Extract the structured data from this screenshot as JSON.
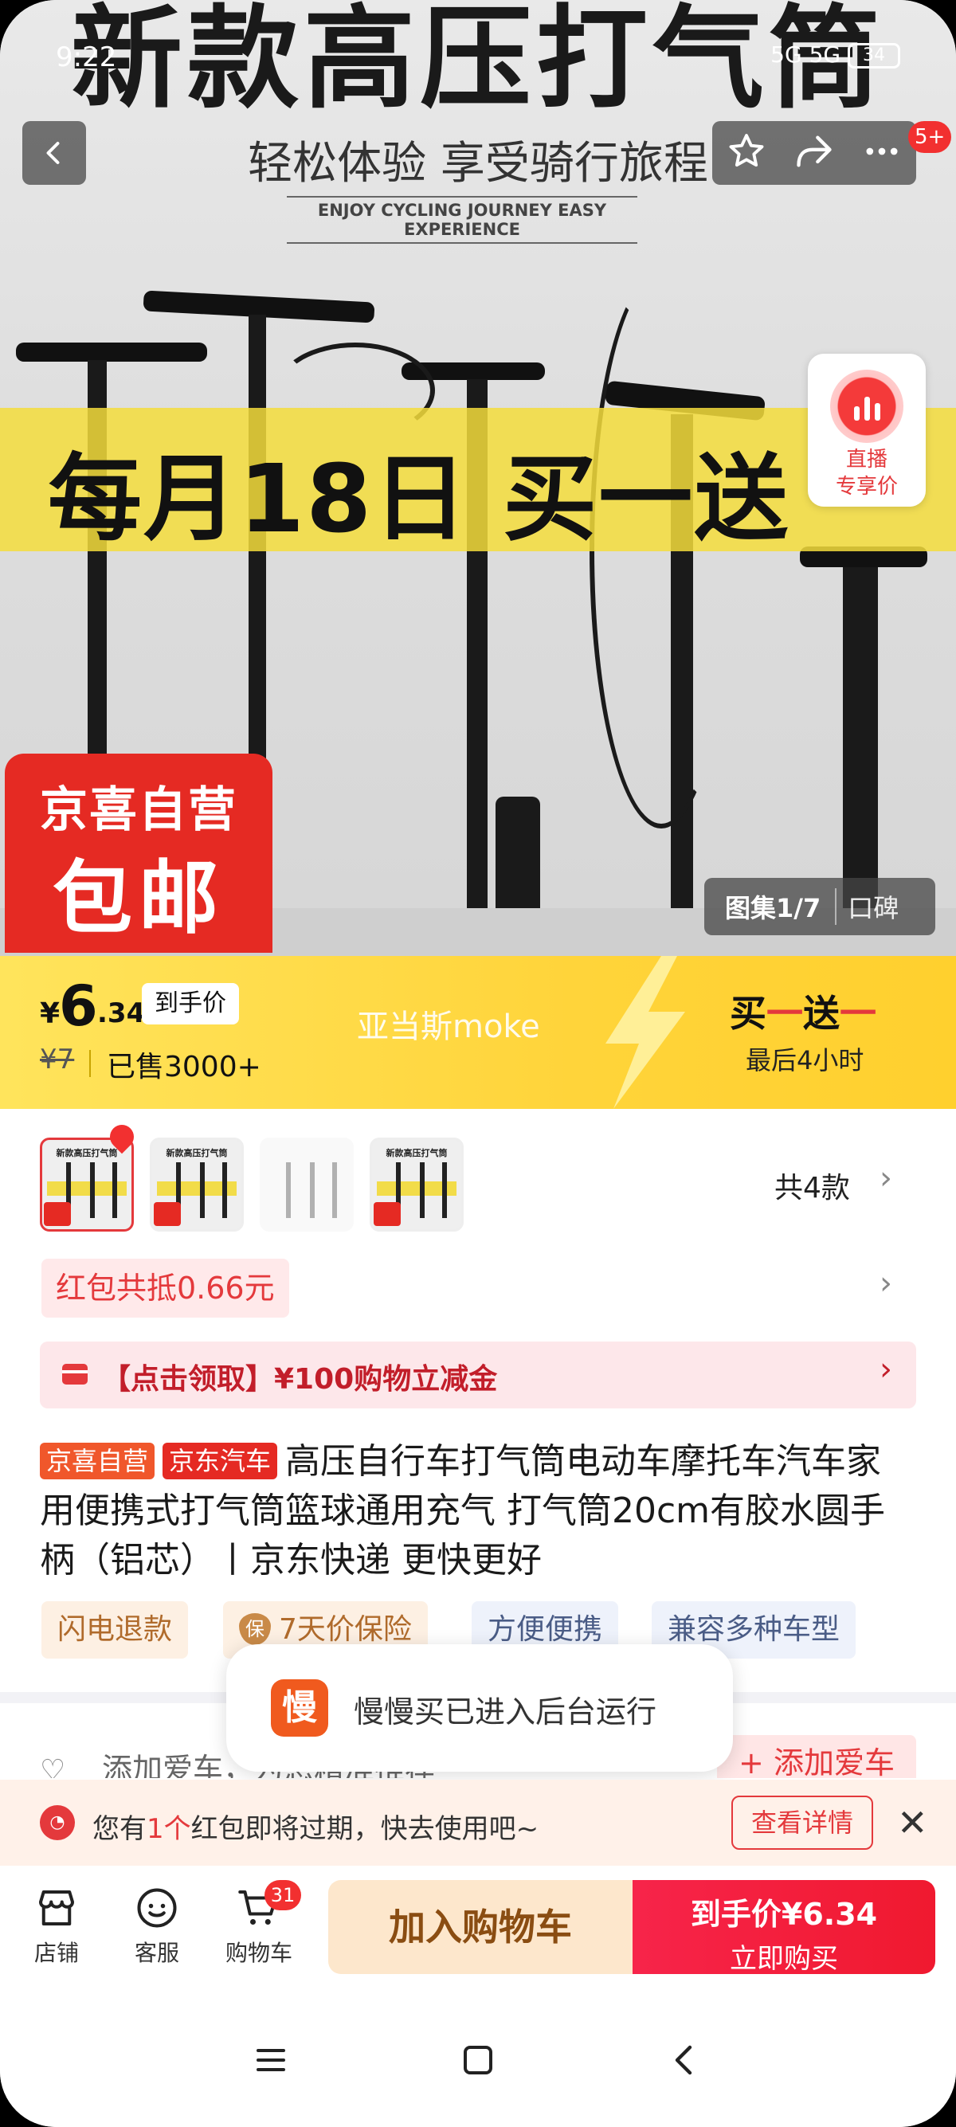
{
  "status_bar": {
    "time": "9:22",
    "network": "5G 5G",
    "battery": "34"
  },
  "hero": {
    "title": "新款高压打气筒",
    "subtitle": "轻松体验 享受骑行旅程",
    "subtitle_en": "ENJOY CYCLING JOURNEY EASY EXPERIENCE",
    "promo": "每月18日 买一送",
    "badge_line1": "京喜自营",
    "badge_line2": "包邮",
    "live_line1": "直播",
    "live_line2": "专享价",
    "gallery": "图集1/7",
    "reviews": "口碑",
    "message_badge": "5+"
  },
  "price_banner": {
    "currency": "¥",
    "price_int": "6",
    "price_dec": ".34",
    "price_tag": "到手价",
    "original_price": "¥7",
    "sold": "已售3000+",
    "watermark": "亚当斯moke",
    "buy_one_a": "买",
    "buy_one_b": "一",
    "buy_one_c": "送",
    "buy_one_d": "一",
    "countdown": "最后4小时"
  },
  "variants": {
    "thumb_title": "新款高压打气筒",
    "label": "共4款"
  },
  "coupon": {
    "label": "红包共抵0.66元"
  },
  "claim": {
    "label": "【点击领取】¥100购物立减金"
  },
  "product": {
    "tag1": "京喜自营",
    "tag2": "京东汽车",
    "title": "高压自行车打气筒电动车摩托车汽车家用便携式打气筒篮球通用充气 打气筒20cm有胶水圆手柄（铝芯）丨京东快递 更快更好"
  },
  "features": [
    "闪电退款",
    "7天价保险",
    "方便便携",
    "兼容多种车型"
  ],
  "feature_icon": "保",
  "toast": {
    "icon": "慢",
    "text": "慢慢买已进入后台运行"
  },
  "car": {
    "text": "添加爱车，为您精准推荐",
    "button": "+ 添加爱车"
  },
  "expire": {
    "pre": "您有",
    "num": "1个",
    "post": "红包即将过期，快去使用吧~",
    "button": "查看详情"
  },
  "bottom_nav": [
    {
      "label": "店铺",
      "icon": "store-icon"
    },
    {
      "label": "客服",
      "icon": "service-icon"
    },
    {
      "label": "购物车",
      "icon": "cart-icon",
      "badge": "31"
    }
  ],
  "actions": {
    "add_cart": "加入购物车",
    "buy_line1": "到手价¥6.34",
    "buy_line2": "立即购买"
  },
  "colors": {
    "accent": "#e4393c",
    "banner": "#ffd43a",
    "promo": "#f4dd3c"
  }
}
